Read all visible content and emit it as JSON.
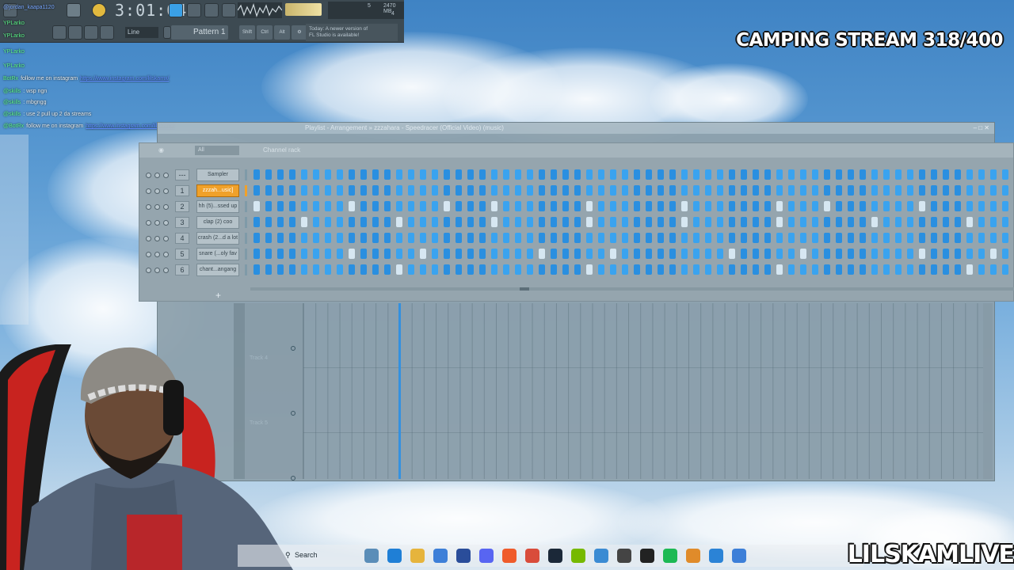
{
  "overlay": {
    "stream_title": "CAMPING STREAM 318/400",
    "watermark": "LILSKAMLIVE"
  },
  "toolbar": {
    "time": "3:01:04",
    "cpu_value": "5",
    "memory": "2470 MB",
    "polyphony": "4",
    "snap_mode": "Line",
    "pattern": "Pattern 1",
    "hint_line1": "Today: A newer version of",
    "hint_line2": "FL Studio is available!",
    "btn_shift": "Shift",
    "btn_ctrl": "Ctrl",
    "btn_alt": "Alt"
  },
  "chat": [
    {
      "name": "@jordan_kaapa1120",
      "text": ""
    },
    {
      "name": "YPLarko",
      "text": ""
    },
    {
      "name": "YPLarko",
      "text": ""
    },
    {
      "name": "YPLarko",
      "text": ""
    },
    {
      "name": "YPLarko",
      "text": ""
    },
    {
      "name": "BotRx",
      "text": "follow me on instagram",
      "link": "https://www.instagram.com/lilskamx/"
    },
    {
      "name": "@skills",
      "text": ": wsp ngn"
    },
    {
      "name": "@skills",
      "text": ": mbgngg"
    },
    {
      "name": "@skills",
      "text": ": use 2 pull up 2 da streams"
    },
    {
      "name": "@BotRx",
      "text": "follow me on instagram",
      "link": "https://www.instagram.com/lilskamx/"
    }
  ],
  "playlist": {
    "title": "Playlist - Arrangement » zzzahara - Speedracer (Official Video) (music)",
    "tracks": [
      "Track 4",
      "Track 5"
    ],
    "playhead_fraction": 0.14
  },
  "channel_rack": {
    "title": "Channel rack",
    "filter": "All",
    "channels": [
      {
        "number": "---",
        "name": "Sampler",
        "selected": false
      },
      {
        "number": "1",
        "name": "zzzah...usic]",
        "selected": true
      },
      {
        "number": "2",
        "name": "hh (5)...ssed up",
        "selected": false
      },
      {
        "number": "3",
        "name": "clap (2) coo",
        "selected": false
      },
      {
        "number": "4",
        "name": "crash (2...d a lot",
        "selected": false
      },
      {
        "number": "5",
        "name": "snare (...oly fav",
        "selected": false
      },
      {
        "number": "6",
        "name": "chant...angang",
        "selected": false
      }
    ],
    "step_count": 64,
    "active_steps": [
      [],
      [],
      [
        0,
        8,
        16,
        20,
        28,
        36,
        44,
        48,
        56
      ],
      [
        4,
        12,
        20,
        28,
        36,
        44,
        52,
        60
      ],
      [],
      [
        8,
        14,
        24,
        30,
        40,
        46,
        56,
        62
      ],
      [
        12,
        28,
        44,
        60
      ]
    ]
  },
  "taskbar": {
    "search": "Search",
    "icons": [
      "weather-icon",
      "edge-icon",
      "files-icon",
      "store-icon",
      "photoshop-icon",
      "discord-icon",
      "brave-icon",
      "chrome-icon",
      "steam-icon",
      "nvidia-icon",
      "app-icon",
      "4k-icon",
      "capcut-icon",
      "spotify-icon",
      "fl-studio-icon",
      "pen-icon",
      "notepad-icon"
    ],
    "icon_colors": [
      "#5a8db8",
      "#1f7fd6",
      "#e6b43c",
      "#3d7fd8",
      "#2a4d9a",
      "#5865f2",
      "#ef5b2b",
      "#d94c3b",
      "#1b2838",
      "#76b900",
      "#3b8bd3",
      "#444444",
      "#222222",
      "#1db954",
      "#e08b2a",
      "#2b83d6",
      "#3d7fd8"
    ]
  }
}
